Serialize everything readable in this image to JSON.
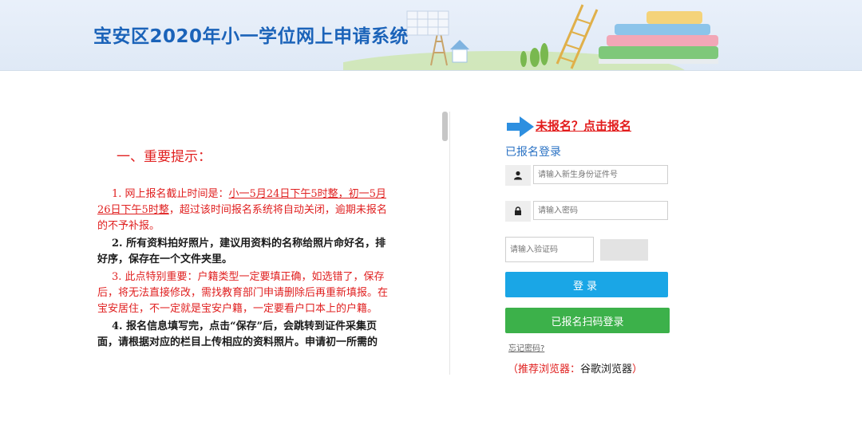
{
  "header": {
    "title": "宝安区2020年小一学位网上申请系统"
  },
  "notice": {
    "section_title": "一、重要提示：",
    "item1_prefix": "1. 网上报名截止时间是：",
    "item1_deadline": "小一5月24日下午5时整，初一5月26日下午5时整",
    "item1_suffix": "，超过该时间报名系统将自动关闭，逾期未报名的不予补报。",
    "item2": "2. 所有资料拍好照片，建议用资料的名称给照片命好名，排好序，保存在一个文件夹里。",
    "item3": "3. 此点特别重要：户籍类型一定要填正确，如选错了，保存后，将无法直接修改，需找教育部门申请删除后再重新填报。在宝安居住，不一定就是宝安户籍，一定要看户口本上的户籍。",
    "item4": "4. 报名信息填写完，点击“保存”后，会跳转到证件采集页面，请根据对应的栏目上传相应的资料照片。申请初一所需的"
  },
  "login": {
    "register_link": "未报名？点击报名",
    "heading": "已报名登录",
    "id_placeholder": "请输入新生身份证件号",
    "password_placeholder": "请输入密码",
    "captcha_placeholder": "请输入验证码",
    "login_button": "登录",
    "qr_login_button": "已报名扫码登录",
    "forgot_password": "忘记密码?",
    "browser_tip_open": "（",
    "browser_tip_label": "推荐浏览器：",
    "browser_tip_value": "谷歌浏览器",
    "browser_tip_close": "）"
  },
  "icons": {
    "user": "user-icon",
    "lock": "lock-icon",
    "arrow": "arrow-right-icon"
  },
  "colors": {
    "brand_blue": "#1b63b9",
    "alert_red": "#e02020",
    "login_blue": "#1aa6e6",
    "qr_green": "#3cb14a"
  }
}
